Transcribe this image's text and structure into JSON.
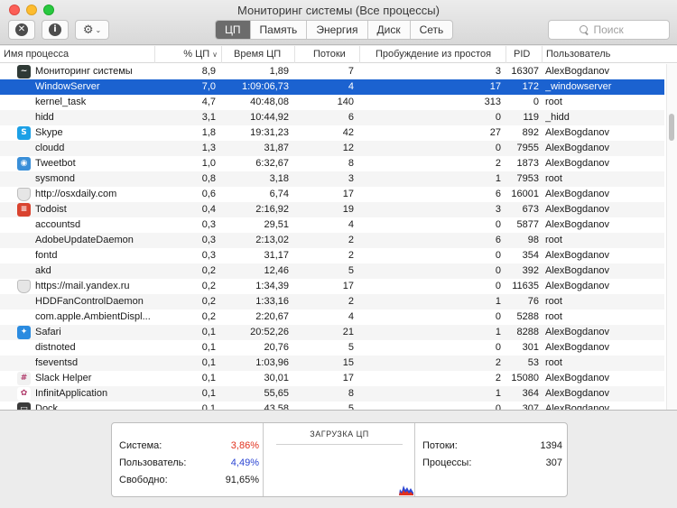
{
  "window": {
    "title": "Мониторинг системы (Все процессы)"
  },
  "toolbar": {
    "tabs": [
      {
        "label": "ЦП",
        "active": true
      },
      {
        "label": "Память",
        "active": false
      },
      {
        "label": "Энергия",
        "active": false
      },
      {
        "label": "Диск",
        "active": false
      },
      {
        "label": "Сеть",
        "active": false
      }
    ],
    "search": {
      "placeholder": "Поиск"
    },
    "stop_glyph": "✕",
    "info_glyph": "i",
    "gear_glyph": "⚙",
    "chevron_glyph": "⌄"
  },
  "table": {
    "columns": {
      "name": "Имя процесса",
      "cpu": "% ЦП",
      "time": "Время ЦП",
      "threads": "Потоки",
      "wakeups": "Пробуждение из простоя",
      "pid": "PID",
      "user": "Пользователь"
    },
    "sort_glyph": "∨",
    "rows": [
      {
        "icon": "activity-monitor-icon",
        "icon_color": "#2f3a36",
        "icon_glyph": "~",
        "name": "Мониторинг системы",
        "cpu": "8,9",
        "time": "1,89",
        "threads": "7",
        "wakeups": "3",
        "pid": "16307",
        "user": "AlexBogdanov",
        "selected": false
      },
      {
        "icon": "",
        "icon_color": "",
        "icon_glyph": "",
        "name": "WindowServer",
        "cpu": "7,0",
        "time": "1:09:06,73",
        "threads": "4",
        "wakeups": "17",
        "pid": "172",
        "user": "_windowserver",
        "selected": true
      },
      {
        "icon": "",
        "icon_color": "",
        "icon_glyph": "",
        "name": "kernel_task",
        "cpu": "4,7",
        "time": "40:48,08",
        "threads": "140",
        "wakeups": "313",
        "pid": "0",
        "user": "root",
        "selected": false
      },
      {
        "icon": "",
        "icon_color": "",
        "icon_glyph": "",
        "name": "hidd",
        "cpu": "3,1",
        "time": "10:44,92",
        "threads": "6",
        "wakeups": "0",
        "pid": "119",
        "user": "_hidd",
        "selected": false
      },
      {
        "icon": "skype-icon",
        "icon_color": "#1ca0e6",
        "icon_glyph": "S",
        "name": "Skype",
        "cpu": "1,8",
        "time": "19:31,23",
        "threads": "42",
        "wakeups": "27",
        "pid": "892",
        "user": "AlexBogdanov",
        "selected": false
      },
      {
        "icon": "",
        "icon_color": "",
        "icon_glyph": "",
        "name": "cloudd",
        "cpu": "1,3",
        "time": "31,87",
        "threads": "12",
        "wakeups": "0",
        "pid": "7955",
        "user": "AlexBogdanov",
        "selected": false
      },
      {
        "icon": "tweetbot-icon",
        "icon_color": "#3a8fd8",
        "icon_glyph": "◉",
        "name": "Tweetbot",
        "cpu": "1,0",
        "time": "6:32,67",
        "threads": "8",
        "wakeups": "2",
        "pid": "1873",
        "user": "AlexBogdanov",
        "selected": false
      },
      {
        "icon": "",
        "icon_color": "",
        "icon_glyph": "",
        "name": "sysmond",
        "cpu": "0,8",
        "time": "3,18",
        "threads": "3",
        "wakeups": "1",
        "pid": "7953",
        "user": "root",
        "selected": false
      },
      {
        "icon": "shield-icon",
        "icon_color": "#e6e6e6",
        "icon_glyph": "",
        "name": "http://osxdaily.com",
        "cpu": "0,6",
        "time": "6,74",
        "threads": "17",
        "wakeups": "6",
        "pid": "16001",
        "user": "AlexBogdanov",
        "selected": false
      },
      {
        "icon": "todoist-icon",
        "icon_color": "#d9432f",
        "icon_glyph": "≡",
        "name": "Todoist",
        "cpu": "0,4",
        "time": "2:16,92",
        "threads": "19",
        "wakeups": "3",
        "pid": "673",
        "user": "AlexBogdanov",
        "selected": false
      },
      {
        "icon": "",
        "icon_color": "",
        "icon_glyph": "",
        "name": "accountsd",
        "cpu": "0,3",
        "time": "29,51",
        "threads": "4",
        "wakeups": "0",
        "pid": "5877",
        "user": "AlexBogdanov",
        "selected": false
      },
      {
        "icon": "",
        "icon_color": "",
        "icon_glyph": "",
        "name": "AdobeUpdateDaemon",
        "cpu": "0,3",
        "time": "2:13,02",
        "threads": "2",
        "wakeups": "6",
        "pid": "98",
        "user": "root",
        "selected": false
      },
      {
        "icon": "",
        "icon_color": "",
        "icon_glyph": "",
        "name": "fontd",
        "cpu": "0,3",
        "time": "31,17",
        "threads": "2",
        "wakeups": "0",
        "pid": "354",
        "user": "AlexBogdanov",
        "selected": false
      },
      {
        "icon": "",
        "icon_color": "",
        "icon_glyph": "",
        "name": "akd",
        "cpu": "0,2",
        "time": "12,46",
        "threads": "5",
        "wakeups": "0",
        "pid": "392",
        "user": "AlexBogdanov",
        "selected": false
      },
      {
        "icon": "shield-icon",
        "icon_color": "#e6e6e6",
        "icon_glyph": "",
        "name": "https://mail.yandex.ru",
        "cpu": "0,2",
        "time": "1:34,39",
        "threads": "17",
        "wakeups": "0",
        "pid": "11635",
        "user": "AlexBogdanov",
        "selected": false
      },
      {
        "icon": "",
        "icon_color": "",
        "icon_glyph": "",
        "name": "HDDFanControlDaemon",
        "cpu": "0,2",
        "time": "1:33,16",
        "threads": "2",
        "wakeups": "1",
        "pid": "76",
        "user": "root",
        "selected": false
      },
      {
        "icon": "",
        "icon_color": "",
        "icon_glyph": "",
        "name": "com.apple.AmbientDispl...",
        "cpu": "0,2",
        "time": "2:20,67",
        "threads": "4",
        "wakeups": "0",
        "pid": "5288",
        "user": "root",
        "selected": false
      },
      {
        "icon": "safari-icon",
        "icon_color": "#2a8be0",
        "icon_glyph": "✦",
        "name": "Safari",
        "cpu": "0,1",
        "time": "20:52,26",
        "threads": "21",
        "wakeups": "1",
        "pid": "8288",
        "user": "AlexBogdanov",
        "selected": false
      },
      {
        "icon": "",
        "icon_color": "",
        "icon_glyph": "",
        "name": "distnoted",
        "cpu": "0,1",
        "time": "20,76",
        "threads": "5",
        "wakeups": "0",
        "pid": "301",
        "user": "AlexBogdanov",
        "selected": false
      },
      {
        "icon": "",
        "icon_color": "",
        "icon_glyph": "",
        "name": "fseventsd",
        "cpu": "0,1",
        "time": "1:03,96",
        "threads": "15",
        "wakeups": "2",
        "pid": "53",
        "user": "root",
        "selected": false
      },
      {
        "icon": "slack-icon",
        "icon_color": "#f1f1f1",
        "icon_glyph": "#",
        "name": "Slack Helper",
        "cpu": "0,1",
        "time": "30,01",
        "threads": "17",
        "wakeups": "2",
        "pid": "15080",
        "user": "AlexBogdanov",
        "selected": false
      },
      {
        "icon": "infinit-icon",
        "icon_color": "#ffffff",
        "icon_glyph": "✿",
        "name": "InfinitApplication",
        "cpu": "0,1",
        "time": "55,65",
        "threads": "8",
        "wakeups": "1",
        "pid": "364",
        "user": "AlexBogdanov",
        "selected": false
      },
      {
        "icon": "dock-icon",
        "icon_color": "#3a3a3a",
        "icon_glyph": "▭",
        "name": "Dock",
        "cpu": "0,1",
        "time": "43,58",
        "threads": "5",
        "wakeups": "0",
        "pid": "307",
        "user": "AlexBogdanov",
        "selected": false
      }
    ]
  },
  "summary": {
    "system_label": "Система:",
    "system_value": "3,86%",
    "user_label": "Пользователь:",
    "user_value": "4,49%",
    "idle_label": "Свободно:",
    "idle_value": "91,65%",
    "cpu_load_title": "ЗАГРУЗКА ЦП",
    "threads_label": "Потоки:",
    "threads_value": "1394",
    "processes_label": "Процессы:",
    "processes_value": "307",
    "colors": {
      "system": "#e1321e",
      "user": "#2b45d3"
    }
  }
}
